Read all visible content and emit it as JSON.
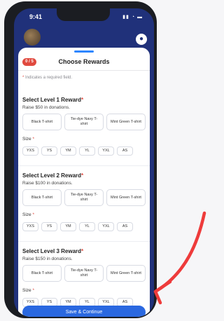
{
  "status": {
    "time": "9:41",
    "icons": "▮▮ ◔ ▬"
  },
  "header": {
    "user_icon": "user-circle-icon"
  },
  "sheet": {
    "step_badge": "0 / 5",
    "title": "Choose Rewards",
    "required_note": "Indicates a required field."
  },
  "rewards": [
    {
      "title": "Select Level 1 Reward",
      "subtitle": "Raise $50 in donations.",
      "options": [
        "Black T-shirt",
        "Tie-dye Navy T-shirt",
        "Mint Green T-shirt"
      ],
      "size_label": "Size",
      "sizes": [
        "YXS",
        "YS",
        "YM",
        "YL",
        "YXL",
        "AS"
      ]
    },
    {
      "title": "Select Level 2 Reward",
      "subtitle": "Raise $100 in donations.",
      "options": [
        "Black T-shirt",
        "Tie-dye Navy T-shirt",
        "Mint Green T-shirt"
      ],
      "size_label": "Size",
      "sizes": [
        "YXS",
        "YS",
        "YM",
        "YL",
        "YXL",
        "AS"
      ]
    },
    {
      "title": "Select Level 3 Reward",
      "subtitle": "Raise $150 in donations.",
      "options": [
        "Black T-shirt",
        "Tie-dye Navy T-shirt",
        "Mint Green T-shirt"
      ],
      "size_label": "Size",
      "sizes": [
        "YXS",
        "YS",
        "YM",
        "YL",
        "YXL",
        "AS"
      ]
    }
  ],
  "footer": {
    "cta_label": "Save & Continue"
  },
  "colors": {
    "brand": "#20317a",
    "accent": "#2a68e0",
    "required": "#e04a3f",
    "annotation_arrow": "#ee3b3b"
  }
}
